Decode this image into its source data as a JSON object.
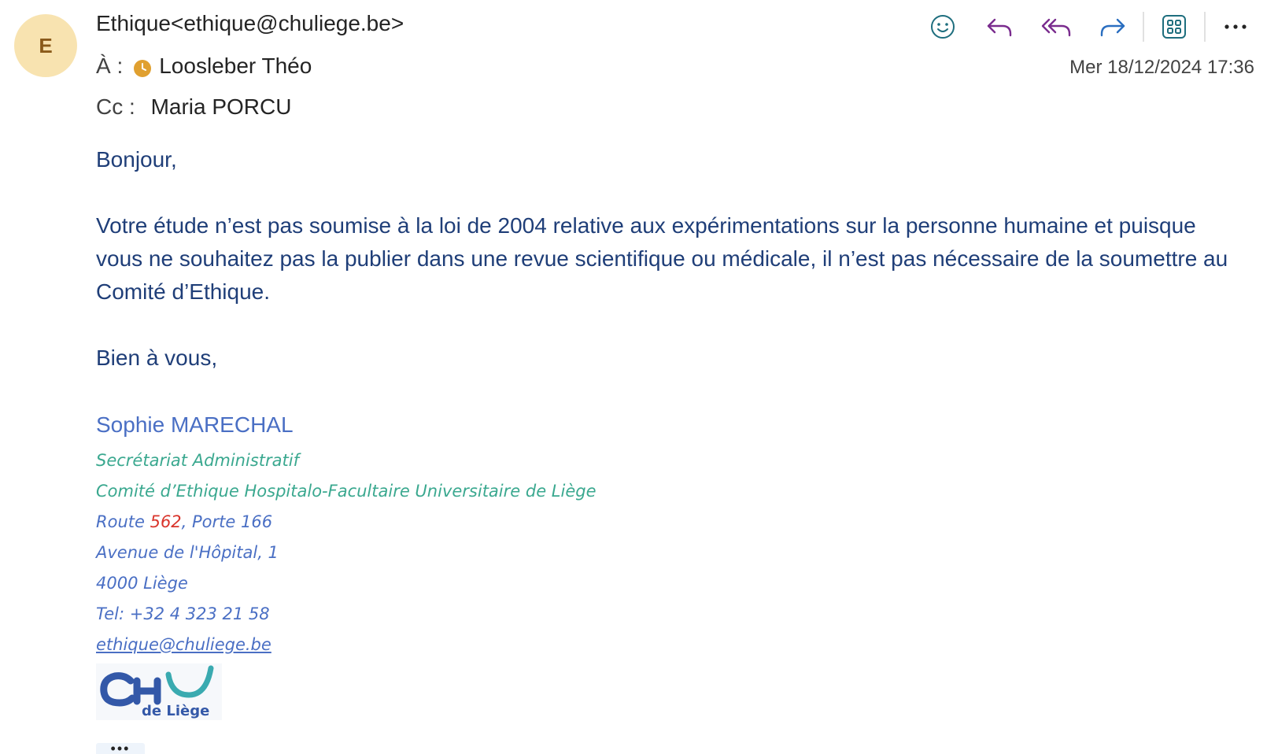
{
  "avatar": {
    "initial": "E",
    "color": "#f8e3b0"
  },
  "header": {
    "from": "Ethique<ethique@chuliege.be>",
    "to_label": "À :",
    "to_name": "Loosleber Théo",
    "cc_label": "Cc :",
    "cc_name": "Maria PORCU",
    "date": "Mer 18/12/2024 17:36"
  },
  "toolbar": {
    "icons": [
      "smiley-icon",
      "reply-icon",
      "reply-all-icon",
      "forward-icon",
      "apps-icon",
      "more-icon"
    ],
    "reply_color": "#7a2c8e",
    "forward_color": "#2a6ec0"
  },
  "body": {
    "greeting": "Bonjour,",
    "paragraph": "Votre étude n’est pas soumise à la loi de 2004 relative aux expérimentations sur la personne humaine et puisque vous ne souhaitez pas la publier dans une revue scientifique ou médicale, il n’est pas nécessaire de la soumettre au Comité d’Ethique.",
    "closing": "Bien à vous,"
  },
  "signature": {
    "name": "Sophie MARECHAL",
    "role": "Secrétariat Administratif",
    "org": "Comité d’Ethique Hospitalo-Facultaire Universitaire de Liège",
    "route_prefix": "Route ",
    "route_number": "562",
    "route_suffix": ", Porte 166",
    "street": "Avenue de l'Hôpital, 1",
    "city": "4000 Liège",
    "tel": "Tel: +32 4 323 21 58",
    "email": "ethique@chuliege.be",
    "logo_text": "CHU de Liège"
  },
  "more": "•••"
}
